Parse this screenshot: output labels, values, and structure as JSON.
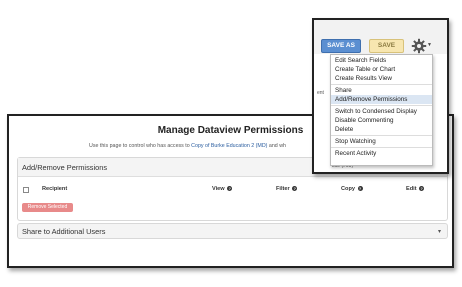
{
  "panel": {
    "title": "Manage Dataview Permissions",
    "subtitle_prefix": "Use this page to control who has access to ",
    "subtitle_link": "Copy of Burke Education 2 (MD)",
    "subtitle_suffix": " and wh"
  },
  "permissions": {
    "header": "Add/Remove Permissions",
    "columns": {
      "recipient": "Recipient",
      "view": "View",
      "filter": "Filter",
      "copy": "Copy",
      "edit": "Edit"
    },
    "remove_button": "Remove Selected"
  },
  "share": {
    "header": "Share to Additional Users"
  },
  "toolbar": {
    "save_as_label": "SAVE AS",
    "save_label": "SAVE"
  },
  "menu": {
    "groups": [
      [
        "Edit Search Fields",
        "Create Table or Chart",
        "Create Results View"
      ],
      [
        "Share",
        "Add/Remove Permissions"
      ],
      [
        "Switch to Condensed Display",
        "Disable Commenting",
        "Delete"
      ],
      [
        "Stop Watching"
      ],
      [
        "Recent Activity"
      ]
    ],
    "active_item": "Add/Remove Permissions"
  },
  "behind": {
    "text1": "ent",
    "text2": "Lite (#09)"
  },
  "colors": {
    "save_as_bg": "#5b8fd1",
    "save_bg": "#f7e6b0",
    "remove_bg": "#e88a8a",
    "menu_active_bg": "#dbe6f3",
    "link": "#2a5d9f"
  }
}
